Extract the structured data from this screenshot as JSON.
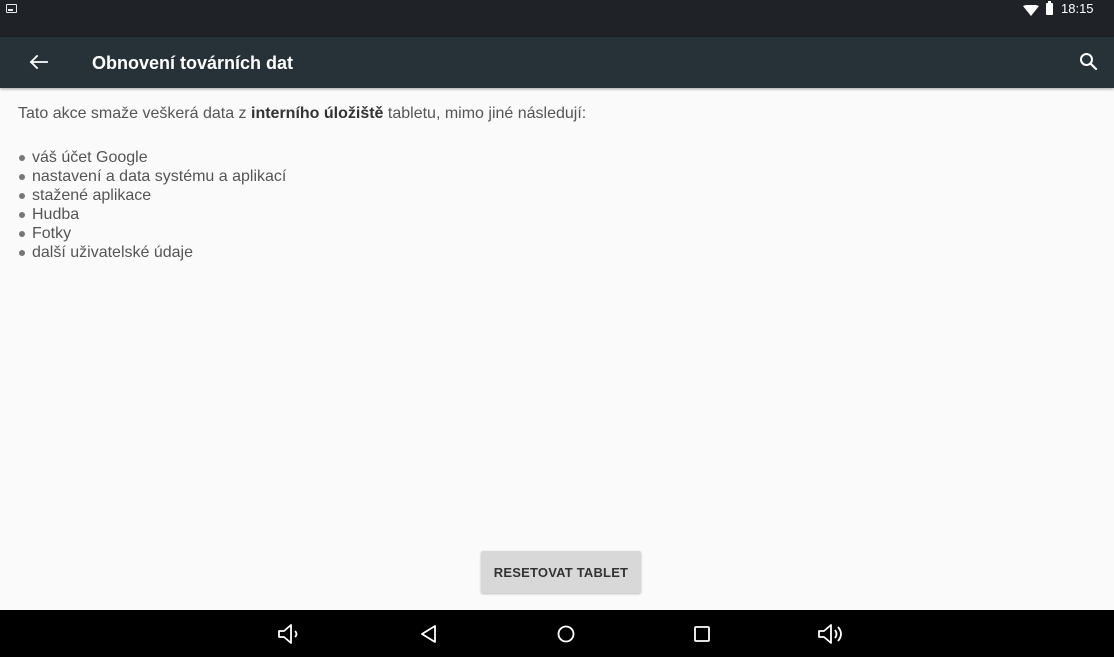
{
  "status_bar": {
    "time": "18:15",
    "icons": [
      "image-notification-icon",
      "wifi-icon",
      "battery-icon"
    ]
  },
  "action_bar": {
    "title": "Obnovení továrních dat",
    "back_icon": "arrow-back-icon",
    "search_icon": "search-icon"
  },
  "content": {
    "intro_before": "Tato akce smaže veškerá data z ",
    "intro_bold": "interního úložiště",
    "intro_after": " tabletu, mimo jiné následují:",
    "items": [
      "váš účet Google",
      "nastavení a data systému a aplikací",
      "stažené aplikace",
      "Hudba",
      "Fotky",
      "další uživatelské údaje"
    ],
    "reset_button_label": "RESETOVAT TABLET"
  },
  "nav_bar": {
    "buttons": [
      "volume-down-icon",
      "back-triangle-icon",
      "home-circle-icon",
      "recents-square-icon",
      "volume-up-icon"
    ]
  },
  "colors": {
    "status_bar": "#1f2327",
    "action_bar": "#263238",
    "background": "#fafafa",
    "button": "#d8d8d8",
    "nav_bar": "#000000"
  }
}
